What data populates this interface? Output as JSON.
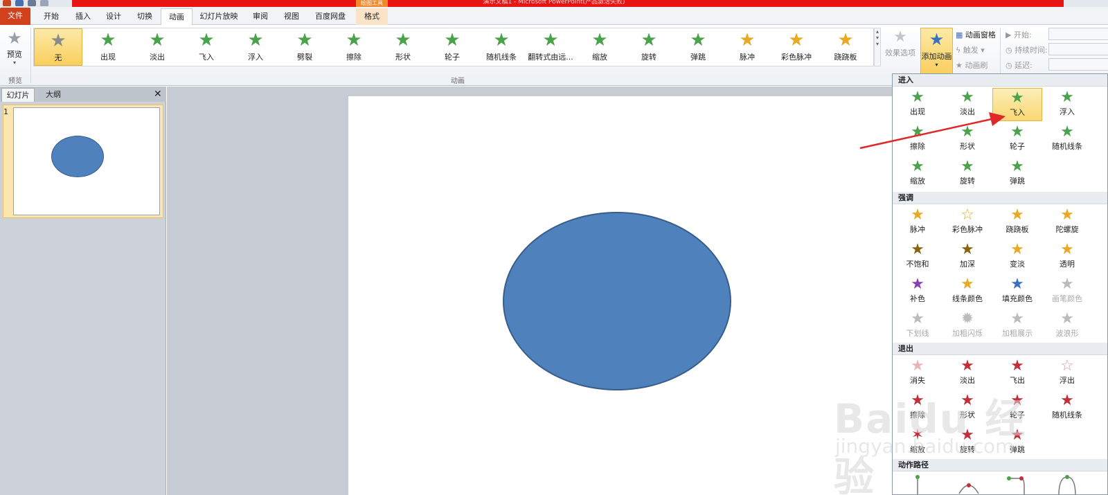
{
  "window": {
    "title": "演示文稿1 - Microsoft PowerPoint(产品激活失败)",
    "context_tab_group": "绘图工具"
  },
  "tabs": [
    "文件",
    "开始",
    "插入",
    "设计",
    "切换",
    "动画",
    "幻灯片放映",
    "审阅",
    "视图",
    "百度网盘",
    "格式"
  ],
  "ribbon": {
    "preview": {
      "label": "预览",
      "group": "预览"
    },
    "animation_group_label": "动画",
    "gallery": [
      {
        "label": "无",
        "icon": "star-gray-icon"
      },
      {
        "label": "出现",
        "icon": "star-green-icon"
      },
      {
        "label": "淡出",
        "icon": "star-green-icon"
      },
      {
        "label": "飞入",
        "icon": "star-green-icon"
      },
      {
        "label": "浮入",
        "icon": "star-green-icon"
      },
      {
        "label": "劈裂",
        "icon": "star-green-icon"
      },
      {
        "label": "擦除",
        "icon": "star-green-icon"
      },
      {
        "label": "形状",
        "icon": "star-green-icon"
      },
      {
        "label": "轮子",
        "icon": "star-green-icon"
      },
      {
        "label": "随机线条",
        "icon": "star-green-icon"
      },
      {
        "label": "翻转式由远...",
        "icon": "star-green-icon"
      },
      {
        "label": "缩放",
        "icon": "star-green-icon"
      },
      {
        "label": "旋转",
        "icon": "star-green-icon"
      },
      {
        "label": "弹跳",
        "icon": "star-green-icon"
      },
      {
        "label": "脉冲",
        "icon": "star-gold-icon"
      },
      {
        "label": "彩色脉冲",
        "icon": "star-gold-icon"
      },
      {
        "label": "跷跷板",
        "icon": "star-gold-icon"
      }
    ],
    "effect_options": "效果选项",
    "add_animation": "添加动画",
    "animation_pane": "动画窗格",
    "trigger": "触发",
    "animation_painter": "动画刷",
    "start_label": "开始:",
    "duration_label": "持续时间:",
    "delay_label": "延迟:"
  },
  "left_pane": {
    "tabs": [
      "幻灯片",
      "大纲"
    ],
    "close": "✕",
    "slide_number": "1"
  },
  "dropdown": {
    "sections": [
      {
        "title": "进入",
        "items": [
          "出现",
          "淡出",
          "飞入",
          "浮入",
          "擦除",
          "形状",
          "轮子",
          "随机线条",
          "缩放",
          "旋转",
          "弹跳"
        ]
      },
      {
        "title": "强调",
        "items": [
          "脉冲",
          "彩色脉冲",
          "跷跷板",
          "陀螺旋",
          "不饱和",
          "加深",
          "变淡",
          "透明",
          "补色",
          "线条颜色",
          "填充颜色",
          "画笔颜色",
          "下划线",
          "加粗闪烁",
          "加粗展示",
          "波浪形"
        ]
      },
      {
        "title": "退出",
        "items": [
          "消失",
          "淡出",
          "飞出",
          "浮出",
          "擦除",
          "形状",
          "轮子",
          "随机线条",
          "缩放",
          "旋转",
          "弹跳"
        ]
      },
      {
        "title": "动作路径",
        "items": []
      }
    ],
    "highlighted": "飞入"
  },
  "watermark": {
    "text": "Baidu 经验",
    "url": "jingyan.baidu.com"
  },
  "colors": {
    "accent_red": "#e81313",
    "shape_fill": "#4f81bd",
    "highlight": "#f9cf5e"
  }
}
